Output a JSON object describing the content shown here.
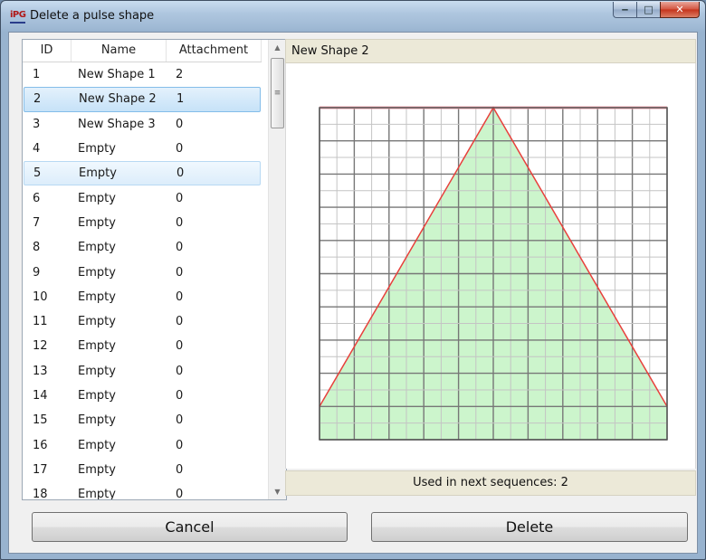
{
  "window": {
    "title": "Delete a pulse shape",
    "app_icon_text": "iPG",
    "controls": {
      "minimize": "‒",
      "maximize": "□",
      "close": "✕"
    }
  },
  "list": {
    "columns": [
      "ID",
      "Name",
      "Attachment"
    ],
    "rows": [
      {
        "id": "1",
        "name": "New Shape 1",
        "attachment": "2"
      },
      {
        "id": "2",
        "name": "New Shape 2",
        "attachment": "1"
      },
      {
        "id": "3",
        "name": "New Shape 3",
        "attachment": "0"
      },
      {
        "id": "4",
        "name": "Empty",
        "attachment": "0"
      },
      {
        "id": "5",
        "name": "Empty",
        "attachment": "0"
      },
      {
        "id": "6",
        "name": "Empty",
        "attachment": "0"
      },
      {
        "id": "7",
        "name": "Empty",
        "attachment": "0"
      },
      {
        "id": "8",
        "name": "Empty",
        "attachment": "0"
      },
      {
        "id": "9",
        "name": "Empty",
        "attachment": "0"
      },
      {
        "id": "10",
        "name": "Empty",
        "attachment": "0"
      },
      {
        "id": "11",
        "name": "Empty",
        "attachment": "0"
      },
      {
        "id": "12",
        "name": "Empty",
        "attachment": "0"
      },
      {
        "id": "13",
        "name": "Empty",
        "attachment": "0"
      },
      {
        "id": "14",
        "name": "Empty",
        "attachment": "0"
      },
      {
        "id": "15",
        "name": "Empty",
        "attachment": "0"
      },
      {
        "id": "16",
        "name": "Empty",
        "attachment": "0"
      },
      {
        "id": "17",
        "name": "Empty",
        "attachment": "0"
      },
      {
        "id": "18",
        "name": "Empty",
        "attachment": "0"
      }
    ],
    "selected_id": "2",
    "hover_id": "5",
    "scrollbar": {
      "up_arrow": "▲",
      "down_arrow": "▼",
      "thumb_grip": "≡"
    }
  },
  "preview": {
    "title": "New Shape 2",
    "footer": "Used in next sequences: 2",
    "shape_points": [
      [
        0,
        0.1
      ],
      [
        0.5,
        1.0
      ],
      [
        1,
        0.1
      ]
    ],
    "colors": {
      "fill": "#ccf5cc",
      "line": "#e8403c",
      "grid_major": "#777777",
      "grid_minor": "#c4c4c4",
      "top_line": "#f4a0ac"
    }
  },
  "buttons": {
    "cancel": "Cancel",
    "delete": "Delete"
  }
}
